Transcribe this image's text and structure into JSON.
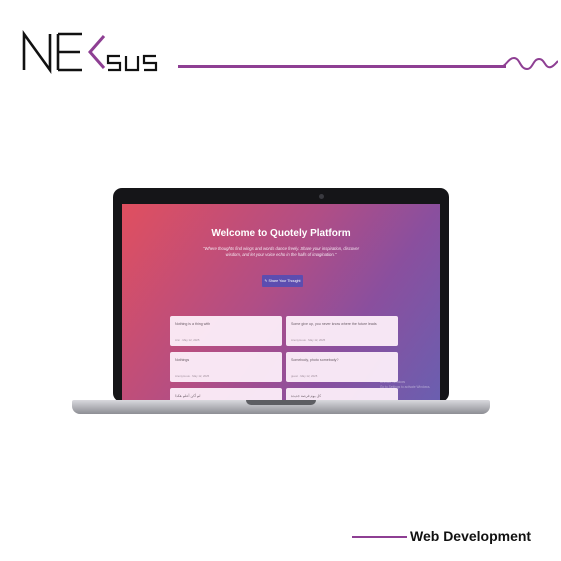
{
  "brand": {
    "logo_text": "NEKSUS"
  },
  "colors": {
    "accent": "#8e3f93",
    "screen_gradient_start": "#e04f5f",
    "screen_gradient_end": "#6a5fb0",
    "button": "#5c4db0"
  },
  "screen": {
    "hero_title": "Welcome to Quotely Platform",
    "hero_text": "\"Where thoughts find wings and words dance freely. Share your inspiration, discover wisdom, and let your voice echo in the halls of imagination.\"",
    "share_button": "✎ Share Your Thought",
    "cards": [
      {
        "text": "Nothing is a thing with",
        "meta": "Ann · May 12, 2025"
      },
      {
        "text": "Some give up, you never know where the future leads",
        "meta": "Anonymous · May 12, 2025"
      },
      {
        "text": "Nothings",
        "meta": "Anonymous · May 12, 2025"
      },
      {
        "text": "Somebody, photo somebody?",
        "meta": "guest · May 12, 2025"
      },
      {
        "text": "لم أكن أعلم هكذا",
        "meta": ""
      },
      {
        "text": "كل يوم فرصة جديدة",
        "meta": ""
      }
    ],
    "watermark_line1": "Activate Windows",
    "watermark_line2": "Go to Settings to activate Windows."
  },
  "footer": {
    "label": "Web Development"
  }
}
